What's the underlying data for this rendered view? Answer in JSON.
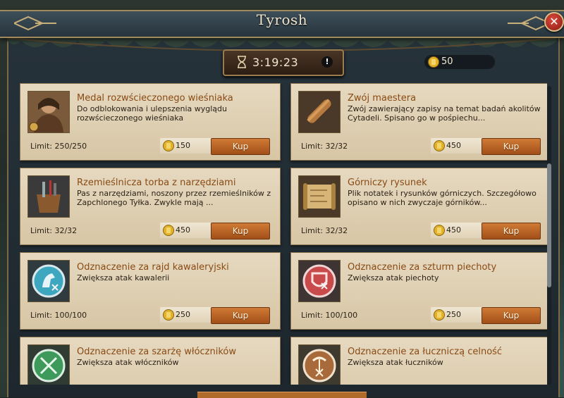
{
  "window": {
    "title": "Tyrosh",
    "close_label": "✕"
  },
  "timer": {
    "time": "3:19:23",
    "info": "!"
  },
  "currency": {
    "amount": "50"
  },
  "items": [
    {
      "name": "Medal rozwścieczonego wieśniaka",
      "desc": "Do odblokowania i ulepszenia wyglądu rozwścieczonego wieśniaka",
      "limit": "Limit: 250/250",
      "price": "150",
      "buy": "Kup",
      "icon": "peasant-portrait-icon"
    },
    {
      "name": "Zwój maestera",
      "desc": "Zwój zawierający zapisy na temat badań akolitów Cytadeli. Spisano go w pośpiechu...",
      "limit": "Limit: 32/32",
      "price": "450",
      "buy": "Kup",
      "icon": "scroll-icon"
    },
    {
      "name": "Rzemieślnicza torba z narzędziami",
      "desc": "Pas z narzędziami, noszony przez rzemieślników z Zapchlonego Tyłka. Zwykle mają ...",
      "limit": "Limit: 32/32",
      "price": "450",
      "buy": "Kup",
      "icon": "tool-bag-icon"
    },
    {
      "name": "Górniczy rysunek",
      "desc": "Plik notatek i rysunków górniczych. Szczegółowo opisano w nich zwyczaje górników...",
      "limit": "Limit: 32/32",
      "price": "450",
      "buy": "Kup",
      "icon": "map-scroll-icon"
    },
    {
      "name": "Odznaczenie za rajd kawaleryjski",
      "desc": "Zwiększa atak kawalerii",
      "limit": "Limit: 100/100",
      "price": "250",
      "buy": "Kup",
      "icon": "cavalry-badge-icon"
    },
    {
      "name": "Odznaczenie za szturm piechoty",
      "desc": "Zwiększa atak piechoty",
      "limit": "Limit: 100/100",
      "price": "250",
      "buy": "Kup",
      "icon": "infantry-badge-icon"
    },
    {
      "name": "Odznaczenie za szarżę włóczników",
      "desc": "Zwiększa atak włóczników",
      "limit": "",
      "price": "",
      "buy": "",
      "icon": "spearmen-badge-icon"
    },
    {
      "name": "Odznaczenie za łuczniczą celność",
      "desc": "Zwiększa atak łuczników",
      "limit": "",
      "price": "",
      "buy": "",
      "icon": "archer-badge-icon"
    }
  ],
  "colors": {
    "accent": "#a24f18",
    "gold": "#e2b22a",
    "parchment": "#e6d9c0"
  }
}
